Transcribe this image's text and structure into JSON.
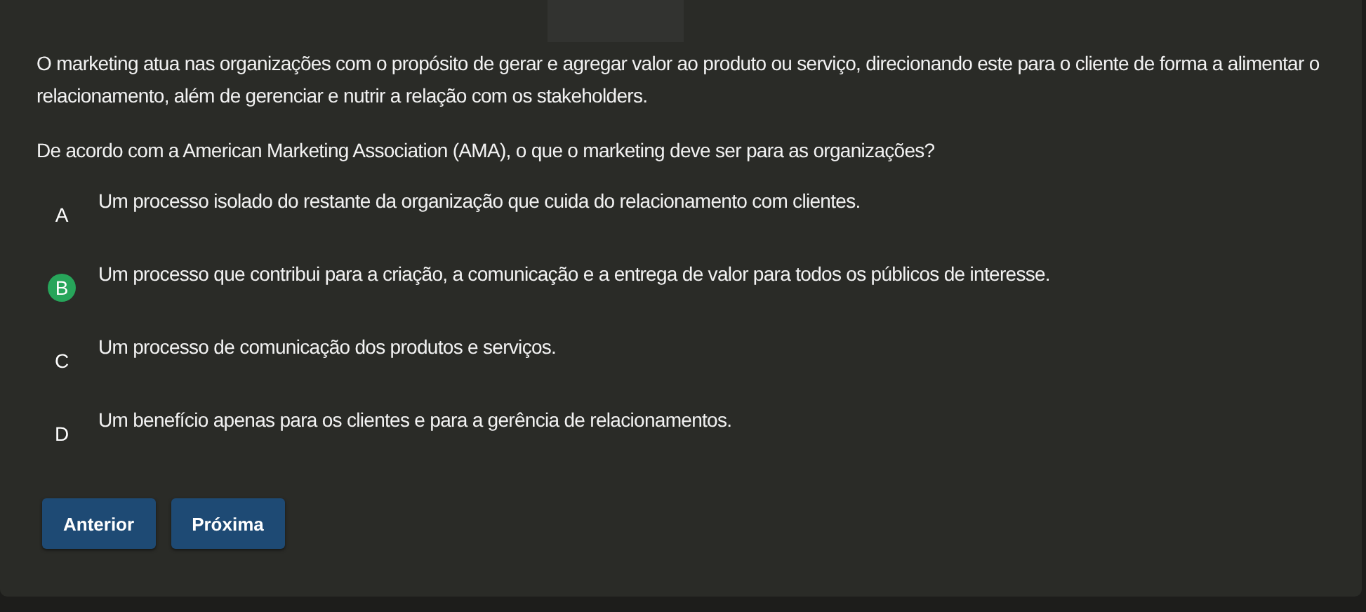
{
  "context": "O marketing atua nas organizações com o propósito de gerar e agregar valor ao produto ou serviço, direcionando este para o cliente de forma a alimentar o relacionamento, além de gerenciar e nutrir a relação com os stakeholders.",
  "question": "De acordo com a American Marketing Association (AMA), o que o marketing deve ser para as organizações?",
  "options": [
    {
      "letter": "A",
      "text": "Um processo isolado do restante da organização que cuida do relacionamento com clientes.",
      "selected": false
    },
    {
      "letter": "B",
      "text": "Um processo que contribui para a criação, a comunicação e a entrega de valor para todos os públicos de interesse.",
      "selected": true
    },
    {
      "letter": "C",
      "text": "Um processo de comunicação dos produtos e serviços.",
      "selected": false
    },
    {
      "letter": "D",
      "text": "Um benefício apenas para os clientes e para a gerência de relacionamentos.",
      "selected": false
    }
  ],
  "buttons": [
    "Anterior",
    "Próxima"
  ]
}
